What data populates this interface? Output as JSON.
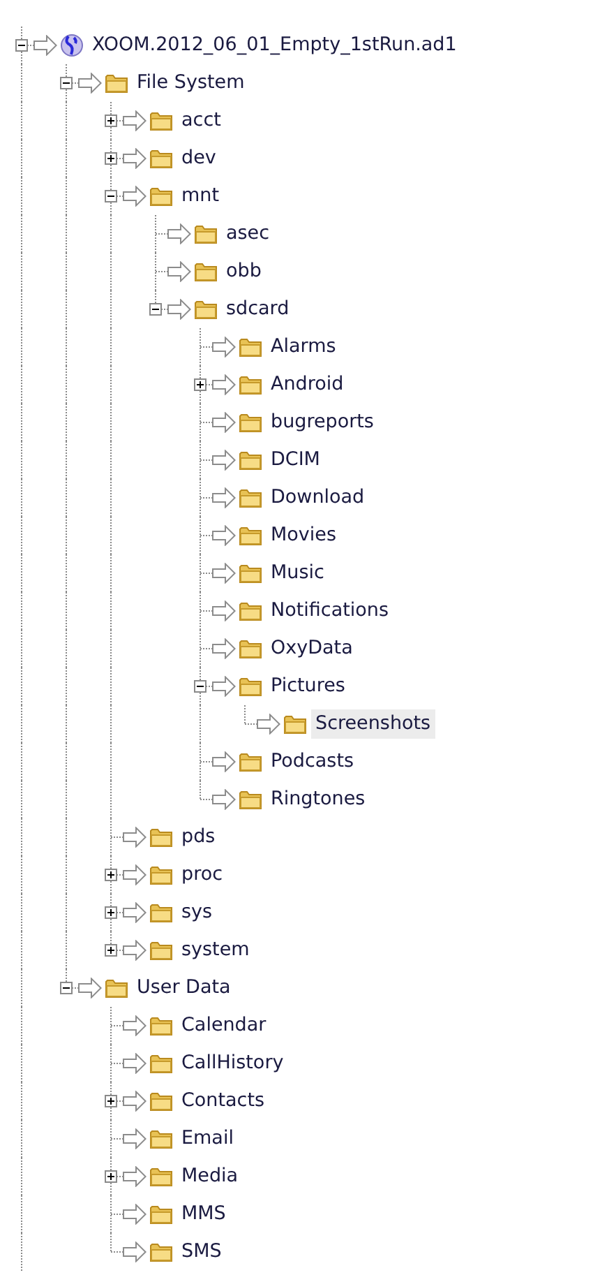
{
  "tree": [
    {
      "label": "XOOM.2012_06_01_Empty_1stRun.ad1",
      "kind": "device",
      "expanded": true,
      "selected": false,
      "children": [
        {
          "label": "File System",
          "kind": "folder",
          "expanded": true,
          "selected": false,
          "children": [
            {
              "label": "acct",
              "kind": "folder",
              "expanded": false,
              "selected": false
            },
            {
              "label": "dev",
              "kind": "folder",
              "expanded": false,
              "selected": false
            },
            {
              "label": "mnt",
              "kind": "folder",
              "expanded": true,
              "selected": false,
              "children": [
                {
                  "label": "asec",
                  "kind": "folder",
                  "selected": false
                },
                {
                  "label": "obb",
                  "kind": "folder",
                  "selected": false
                },
                {
                  "label": "sdcard",
                  "kind": "folder",
                  "expanded": true,
                  "selected": false,
                  "children": [
                    {
                      "label": "Alarms",
                      "kind": "folder",
                      "selected": false
                    },
                    {
                      "label": "Android",
                      "kind": "folder",
                      "expanded": false,
                      "selected": false
                    },
                    {
                      "label": "bugreports",
                      "kind": "folder",
                      "selected": false
                    },
                    {
                      "label": "DCIM",
                      "kind": "folder",
                      "selected": false
                    },
                    {
                      "label": "Download",
                      "kind": "folder",
                      "selected": false
                    },
                    {
                      "label": "Movies",
                      "kind": "folder",
                      "selected": false
                    },
                    {
                      "label": "Music",
                      "kind": "folder",
                      "selected": false
                    },
                    {
                      "label": "Notifications",
                      "kind": "folder",
                      "selected": false
                    },
                    {
                      "label": "OxyData",
                      "kind": "folder",
                      "selected": false
                    },
                    {
                      "label": "Pictures",
                      "kind": "folder",
                      "expanded": true,
                      "selected": false,
                      "children": [
                        {
                          "label": "Screenshots",
                          "kind": "folder",
                          "selected": true
                        }
                      ]
                    },
                    {
                      "label": "Podcasts",
                      "kind": "folder",
                      "selected": false
                    },
                    {
                      "label": "Ringtones",
                      "kind": "folder",
                      "selected": false
                    }
                  ]
                }
              ]
            },
            {
              "label": "pds",
              "kind": "folder",
              "selected": false
            },
            {
              "label": "proc",
              "kind": "folder",
              "expanded": false,
              "selected": false
            },
            {
              "label": "sys",
              "kind": "folder",
              "expanded": false,
              "selected": false
            },
            {
              "label": "system",
              "kind": "folder",
              "expanded": false,
              "selected": false
            }
          ]
        },
        {
          "label": "User Data",
          "kind": "folder",
          "expanded": true,
          "selected": false,
          "children": [
            {
              "label": "Calendar",
              "kind": "folder",
              "selected": false
            },
            {
              "label": "CallHistory",
              "kind": "folder",
              "selected": false
            },
            {
              "label": "Contacts",
              "kind": "folder",
              "expanded": false,
              "selected": false
            },
            {
              "label": "Email",
              "kind": "folder",
              "selected": false
            },
            {
              "label": "Media",
              "kind": "folder",
              "expanded": false,
              "selected": false
            },
            {
              "label": "MMS",
              "kind": "folder",
              "selected": false
            },
            {
              "label": "SMS",
              "kind": "folder",
              "selected": false
            }
          ]
        }
      ]
    }
  ]
}
